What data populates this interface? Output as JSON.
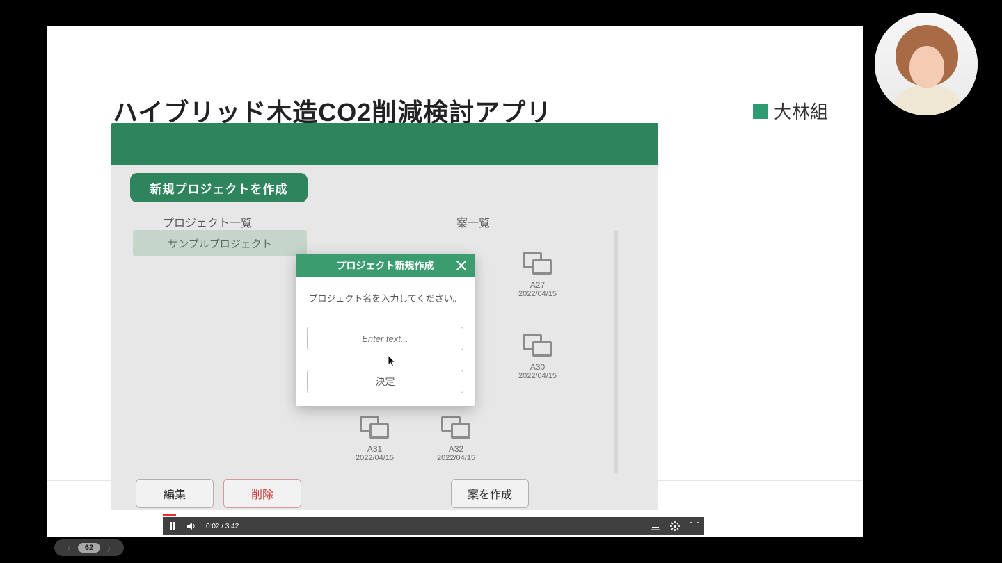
{
  "slide": {
    "title": "ハイブリッド木造CO2削減検討アプリ",
    "company": "大林組"
  },
  "app": {
    "new_project_label": "新規プロジェクトを作成",
    "project_list_heading": "プロジェクト一覧",
    "case_list_heading": "案一覧",
    "sample_project_label": "サンプルプロジェクト",
    "cases": [
      {
        "name": "A27",
        "date": "2022/04/15"
      },
      {
        "name": "A30",
        "date": "2022/04/15"
      },
      {
        "name": "A31",
        "date": "2022/04/15"
      },
      {
        "name": "A32",
        "date": "2022/04/15"
      }
    ],
    "bottom_buttons": {
      "edit": "編集",
      "delete": "削除",
      "create_case": "案を作成"
    }
  },
  "modal": {
    "title": "プロジェクト新規作成",
    "message": "プロジェクト名を入力してください。",
    "placeholder": "Enter text...",
    "confirm": "決定"
  },
  "video": {
    "current": "0:02",
    "duration": "3:42"
  },
  "pager": {
    "current": "62"
  },
  "colors": {
    "accent": "#2e845c",
    "danger": "#d23f3f"
  }
}
